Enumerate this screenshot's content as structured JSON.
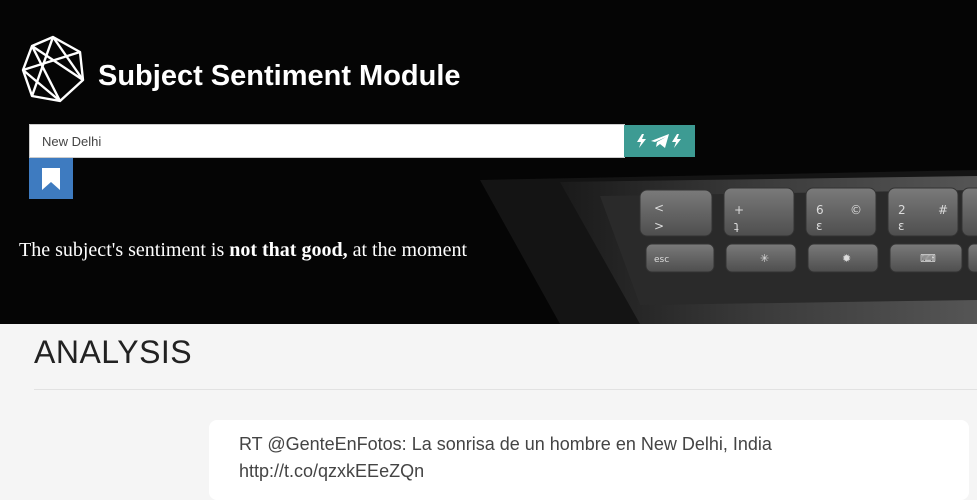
{
  "header": {
    "title": "Subject Sentiment Module",
    "logo_icon": "polyhedron-logo-icon"
  },
  "search": {
    "value": "New Delhi",
    "go_icon": "bolt-send-bolt-icon",
    "bookmark_icon": "bookmark-icon"
  },
  "sentiment": {
    "prefix": "The subject's sentiment is",
    "verdict": "not that good,",
    "suffix": "at the moment"
  },
  "analysis": {
    "heading": "ANALYSIS",
    "tweets": [
      {
        "text_line1": "RT @GenteEnFotos: La sonrisa de un hombre en New Delhi, India",
        "text_line2": "http://t.co/qzxkEEeZQn"
      }
    ]
  },
  "colors": {
    "hero_bg": "#050505",
    "go_button": "#3d9b93",
    "bookmark_button": "#3e7bc0",
    "page_bg": "#f5f5f5"
  },
  "keyboard": {
    "row1": [
      "<",
      "+",
      "6",
      "©",
      "2",
      "#"
    ],
    "row1_sub": [
      ">",
      "ʇ",
      "ɛ",
      "",
      "ɛ",
      ""
    ],
    "row2": [
      "esc",
      "✳",
      "✹",
      "⌨"
    ]
  }
}
